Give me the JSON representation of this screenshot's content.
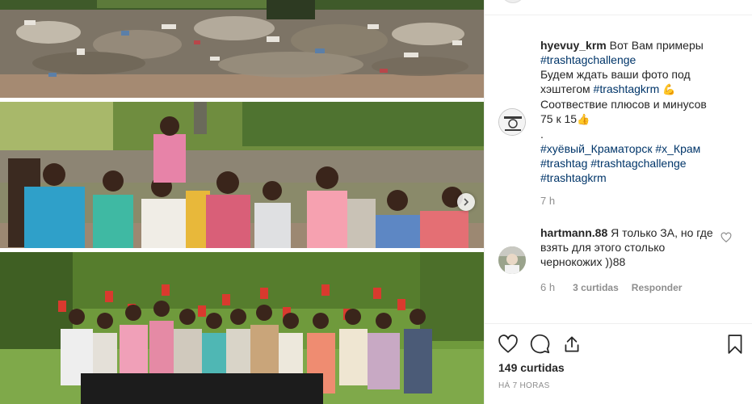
{
  "carousel": {
    "next_icon": "chevron-right-icon"
  },
  "caption": {
    "username": "hyevuy_krm",
    "lines": [
      "Вот Вам примеры",
      "#trashtagchallenge",
      "Будем ждать ваши фото под",
      "хэштегом",
      "#trashtagkrm",
      "Соотвествие плюсов и минусов",
      "75 к 15",
      ".",
      "#хуёвый_Краматорск #х_Крам",
      "#trashtag #trashtagchallenge",
      "#trashtagkrm"
    ],
    "emoji_flex": "💪",
    "emoji_thumb": "👍",
    "time": "7 h"
  },
  "comment": {
    "username": "hartmann.88",
    "lines": [
      "Я только ЗА, но где",
      "взять для этого столько",
      "чернокожих ))88"
    ],
    "time": "6 h",
    "likes": "3 curtidas",
    "reply": "Responder"
  },
  "actions": {
    "like_icon": "heart-icon",
    "comment_icon": "comment-icon",
    "share_icon": "share-icon",
    "save_icon": "bookmark-icon"
  },
  "likes_count": "149 curtidas",
  "posted_ago": "HÁ 7 HORAS",
  "colors": {
    "link": "#003569",
    "muted": "#8e8e8e",
    "text": "#262626",
    "divider": "#efefef"
  }
}
